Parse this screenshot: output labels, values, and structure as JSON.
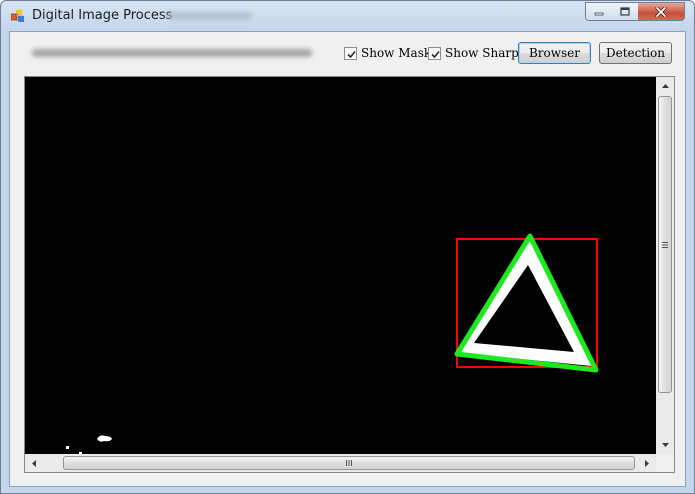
{
  "window": {
    "title": "Digital Image Process",
    "controls": {
      "minimize": "minimize-icon",
      "maximize": "maximize-icon",
      "close": "close-icon"
    }
  },
  "toolbar": {
    "show_mask": {
      "label": "Show Mask",
      "checked": true
    },
    "show_sharp": {
      "label": "Show Sharp",
      "checked": true
    },
    "browser_label": "Browser",
    "detection_label": "Detection"
  },
  "viewer": {
    "background": "#000000",
    "detection_box_color": "#ff0000",
    "detected_outline_color": "#00ff00",
    "mask_color": "#ffffff"
  }
}
